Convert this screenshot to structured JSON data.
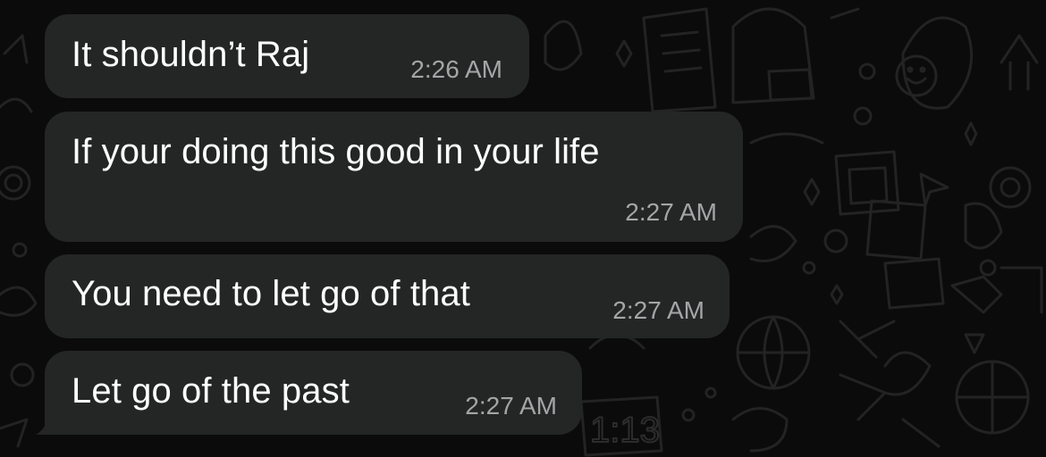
{
  "messages": [
    {
      "text": "It shouldn’t Raj",
      "time": "2:26 AM"
    },
    {
      "text": "If your doing this good in your life",
      "time": "2:27 AM"
    },
    {
      "text": "You need to let go of that",
      "time": "2:27 AM"
    },
    {
      "text": "Let go of the past",
      "time": "2:27 AM"
    }
  ],
  "background_clock_text": "1:13",
  "colors": {
    "background": "#0b0b0b",
    "bubble": "#242626",
    "text": "#ffffff",
    "timestamp": "#a3a6a7",
    "doodle": "#232323"
  }
}
